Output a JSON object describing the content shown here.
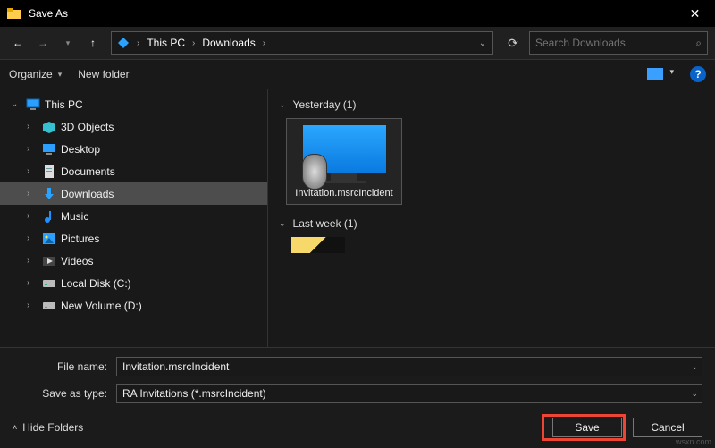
{
  "title": "Save As",
  "breadcrumb": {
    "root": "This PC",
    "folder": "Downloads"
  },
  "search": {
    "placeholder": "Search Downloads"
  },
  "toolbar": {
    "organize": "Organize",
    "newfolder": "New folder"
  },
  "tree": {
    "parent": "This PC",
    "items": [
      {
        "label": "3D Objects",
        "icon": "cube"
      },
      {
        "label": "Desktop",
        "icon": "desktop"
      },
      {
        "label": "Documents",
        "icon": "doc"
      },
      {
        "label": "Downloads",
        "icon": "download",
        "selected": true
      },
      {
        "label": "Music",
        "icon": "music"
      },
      {
        "label": "Pictures",
        "icon": "pic"
      },
      {
        "label": "Videos",
        "icon": "video"
      },
      {
        "label": "Local Disk (C:)",
        "icon": "disk"
      },
      {
        "label": "New Volume (D:)",
        "icon": "disk"
      }
    ]
  },
  "groups": {
    "g1": "Yesterday (1)",
    "g2": "Last week (1)"
  },
  "file": {
    "name": "Invitation.msrcIncident"
  },
  "form": {
    "filename_label": "File name:",
    "filename_value": "Invitation.msrcIncident",
    "type_label": "Save as type:",
    "type_value": "RA Invitations (*.msrcIncident)"
  },
  "buttons": {
    "hide": "Hide Folders",
    "save": "Save",
    "cancel": "Cancel"
  },
  "watermark": "wsxn.com"
}
